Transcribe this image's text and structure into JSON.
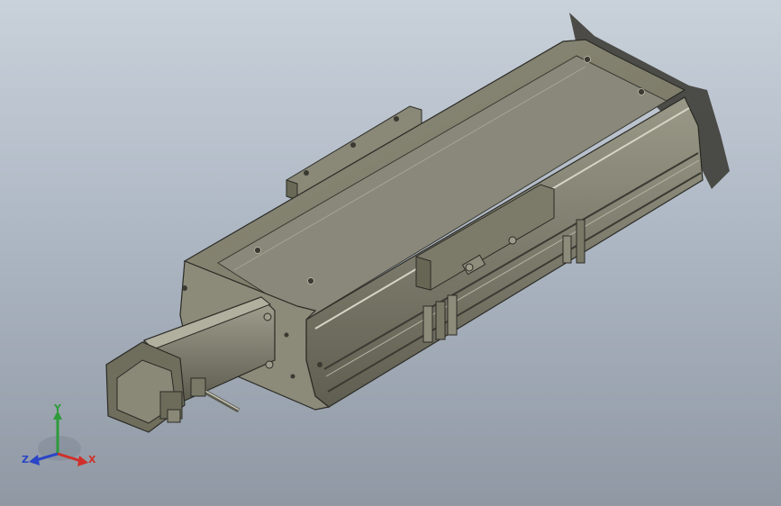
{
  "colors": {
    "background_top": "#c9d1da",
    "background_bottom": "#8f98a3",
    "body_face": "#7f7d6c",
    "body_light": "#9a9887",
    "body_dark": "#55544a",
    "edge": "#2b2b26",
    "x_axis": "#d0302a",
    "y_axis": "#2e9b3a",
    "z_axis": "#2b45c6"
  },
  "triad": {
    "x_label": "X",
    "y_label": "Y",
    "z_label": "Z"
  }
}
